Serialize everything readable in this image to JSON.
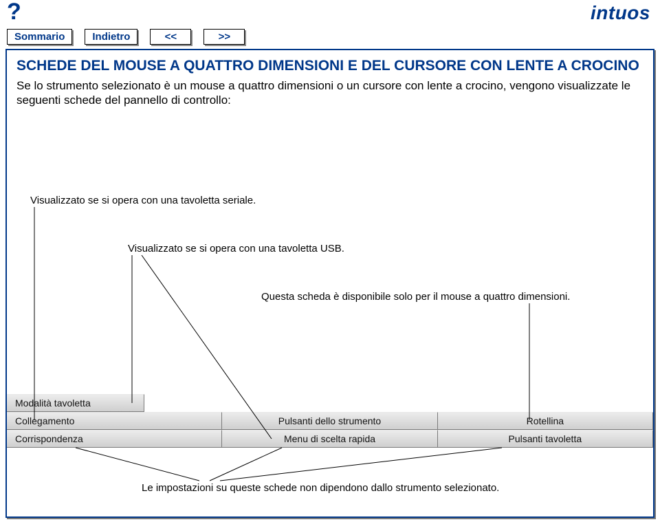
{
  "topbar": {
    "help": "?",
    "logo": "intuos"
  },
  "nav": {
    "summary": "Sommario",
    "back": "Indietro",
    "prev": "<<",
    "next": ">>"
  },
  "content": {
    "heading": "SCHEDE DEL MOUSE A QUATTRO DIMENSIONI E DEL CURSORE CON LENTE A CROCINO",
    "paragraph": "Se lo strumento selezionato è un mouse a quattro dimensioni o un cursore con lente a crocino, vengono visualizzate le seguenti schede del pannello di controllo:"
  },
  "annotations": {
    "serial": "Visualizzato se si opera con una tavoletta seriale.",
    "usb": "Visualizzato se si opera con una tavoletta USB.",
    "fourd": "Questa scheda è disponibile solo per il mouse a quattro dimensioni.",
    "footer": "Le impostazioni su queste schede non dipendono dallo strumento selezionato."
  },
  "tabs": {
    "row1": {
      "t1": "Modalità tavoletta"
    },
    "row2": {
      "t1": "Collegamento",
      "t2": "Pulsanti dello strumento",
      "t3": "Rotellina"
    },
    "row3": {
      "t1": "Corrispondenza",
      "t2": "Menu di scelta rapida",
      "t3": "Pulsanti tavoletta"
    }
  }
}
